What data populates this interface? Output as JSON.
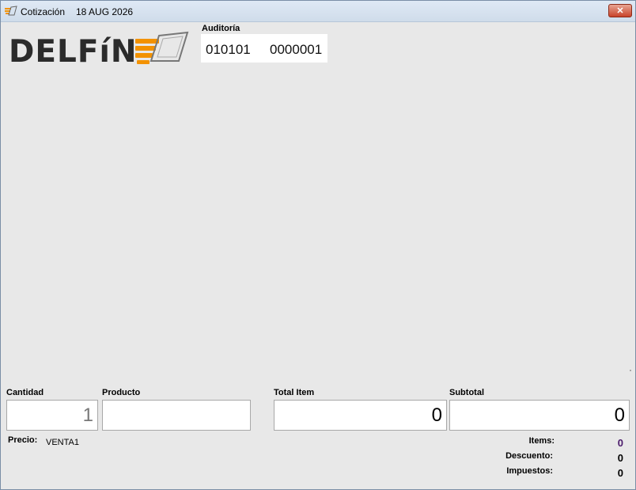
{
  "window": {
    "title": "Cotización",
    "date": "18 AUG 2026",
    "close_label": "✕"
  },
  "logo": {
    "text": "DELFíN"
  },
  "auditoria": {
    "label": "Auditoría",
    "value1": "010101",
    "value2": "0000001"
  },
  "form": {
    "cantidad_label": "Cantidad",
    "cantidad_value": "1",
    "producto_label": "Producto",
    "producto_value": "",
    "total_item_label": "Total Item",
    "total_item_value": "0",
    "subtotal_label": "Subtotal",
    "subtotal_value": "0"
  },
  "precio": {
    "label": "Precio:",
    "value": "VENTA1"
  },
  "summary": {
    "items_label": "Items:",
    "items_value": "0",
    "descuento_label": "Descuento:",
    "descuento_value": "0",
    "impuestos_label": "Impuestos:",
    "impuestos_value": "0"
  },
  "colors": {
    "items_value": "#4a1a6b",
    "logo_orange": "#f39200",
    "logo_dark": "#2b2b2b"
  }
}
